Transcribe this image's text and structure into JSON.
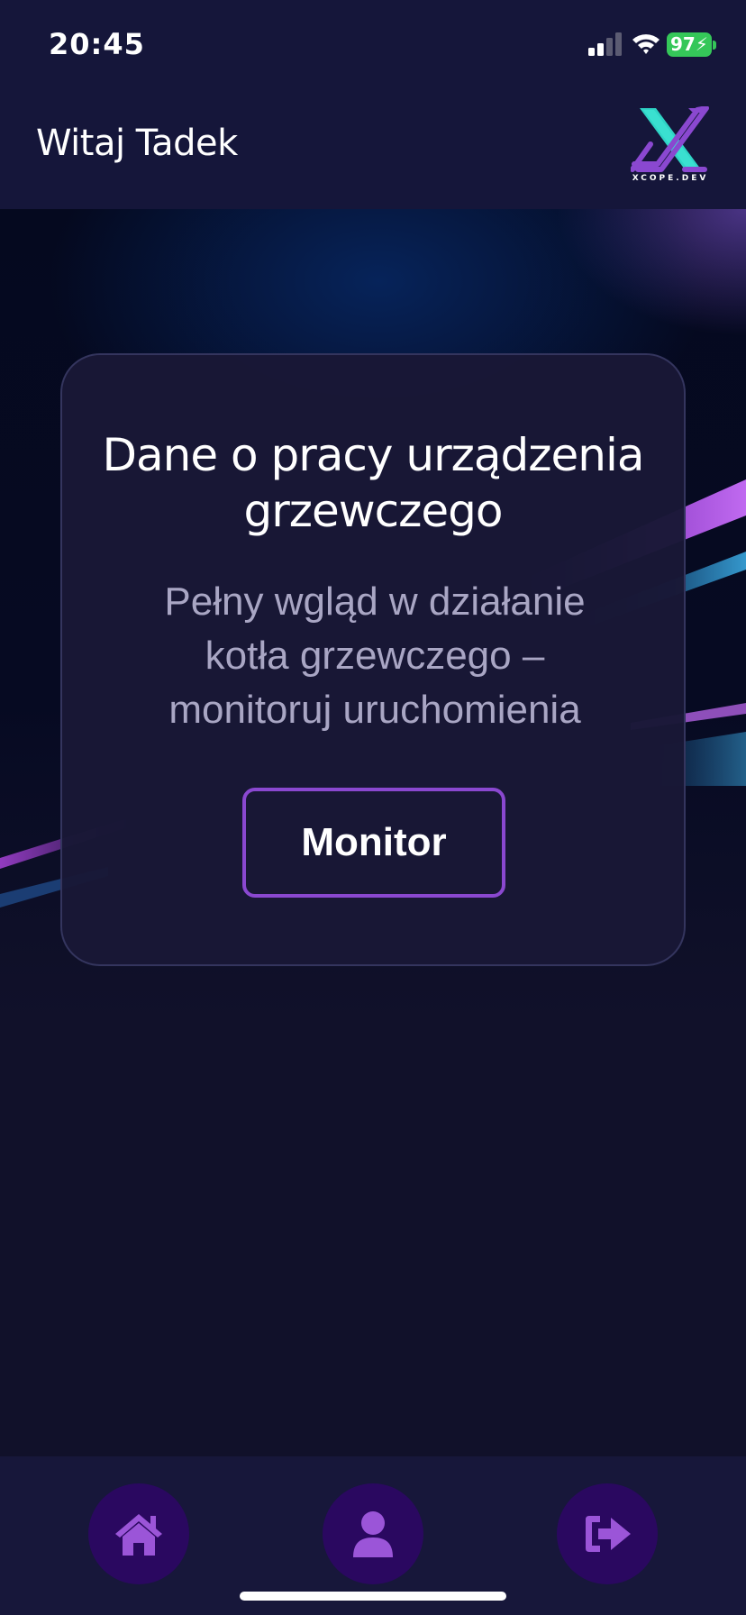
{
  "status_bar": {
    "time": "20:45",
    "battery": "97"
  },
  "header": {
    "greeting": "Witaj Tadek",
    "logo_text": "XCOPE.DEV"
  },
  "card": {
    "title": "Dane o pracy urządzenia grzewczego",
    "description": "Pełny wgląd w działanie kotła grzewczego – monitoruj uruchomienia",
    "button_label": "Monitor"
  },
  "tab_bar": {
    "items": [
      {
        "icon": "home-icon"
      },
      {
        "icon": "user-icon"
      },
      {
        "icon": "logout-icon"
      }
    ]
  },
  "colors": {
    "accent": "#8a48d0",
    "tab_button": "#2a0860",
    "battery": "#35c759",
    "background": "#11112a"
  }
}
